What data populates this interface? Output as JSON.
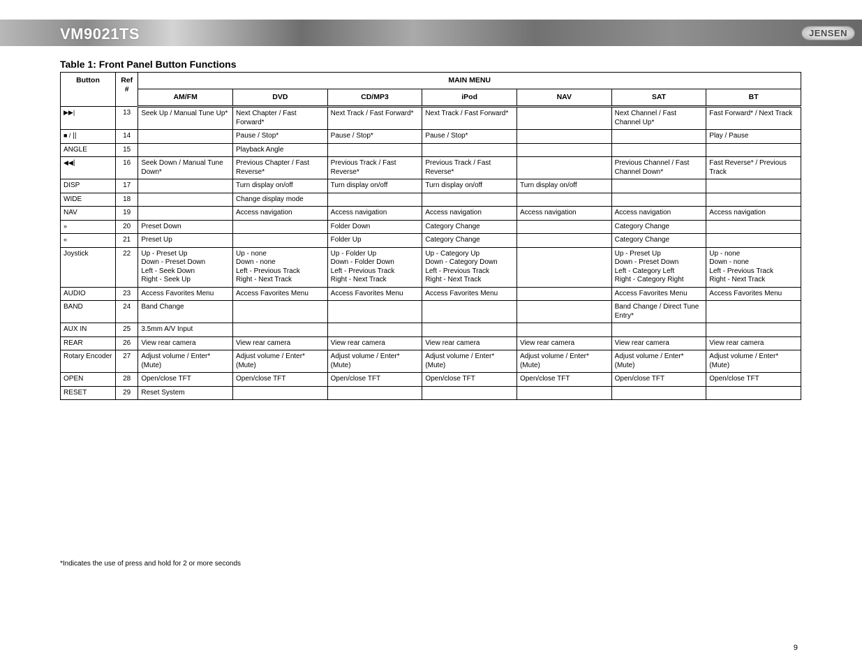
{
  "productTitle": "VM9021TS",
  "sectionTitle": "Table 1: Front Panel Button Functions",
  "logoText": "JENSEN",
  "pageNumber": "9",
  "headers": {
    "button": "Button",
    "ref": "Ref #",
    "main": "MAIN MENU",
    "modes": [
      "AM/FM",
      "DVD",
      "CD/MP3",
      "iPod",
      "NAV",
      "SAT",
      "BT"
    ]
  },
  "icons": {
    "next": "▶▶|",
    "stopPlay": "■ /",
    "rewind": "◀◀",
    "navDown": "»",
    "navUp": "«"
  },
  "rows": [
    {
      "button": "",
      "ref": "13",
      "cells": [
        "Seek Up / Manual Tune Up*",
        "Next Chapter / Fast Forward*",
        "Next Track / Fast Forward*",
        "Next Track / Fast Forward*",
        "",
        "Next Channel / Fast Channel Up*",
        "Fast Forward* / Next Track"
      ]
    },
    {
      "button": "   ||",
      "ref": "14",
      "cells": [
        "",
        "Pause / Stop*",
        "Pause / Stop*",
        "Pause / Stop*",
        "",
        "",
        "Play / Pause"
      ]
    },
    {
      "button": "ANGLE",
      "ref": "15",
      "cells": [
        "",
        "Playback Angle",
        "",
        "",
        "",
        "",
        ""
      ]
    },
    {
      "button": "|",
      "ref": "16",
      "cells": [
        "Seek Down / Manual Tune Down*",
        "Previous Chapter / Fast Reverse*",
        "Previous Track / Fast Reverse*",
        "Previous Track / Fast Reverse*",
        "",
        "Previous Channel / Fast Channel Down*",
        "Fast Reverse* / Previous Track"
      ]
    },
    {
      "button": "DISP",
      "ref": "17",
      "cells": [
        "",
        "Turn display on/off",
        "Turn display on/off",
        "Turn display on/off",
        "Turn display on/off",
        "",
        ""
      ]
    },
    {
      "button": "WIDE",
      "ref": "18",
      "cells": [
        "",
        "Change display mode",
        "",
        "",
        "",
        "",
        ""
      ]
    },
    {
      "button": "NAV",
      "ref": "19",
      "cells": [
        "",
        "Access navigation",
        "Access navigation",
        "Access navigation",
        "Access navigation",
        "Access navigation",
        "Access navigation"
      ]
    },
    {
      "button": "",
      "ref": "20",
      "cells": [
        "Preset Down",
        "",
        "Folder Down",
        "Category Change",
        "",
        "Category Change",
        ""
      ]
    },
    {
      "button": "",
      "ref": "21",
      "cells": [
        "Preset Up",
        "",
        "Folder Up",
        "Category Change",
        "",
        "Category Change",
        ""
      ]
    },
    {
      "button": "Joystick",
      "ref": "22",
      "cells": [
        "Up - Preset Up\nDown - Preset Down\nLeft - Seek Down\nRight - Seek Up",
        "Up - none\nDown - none\nLeft - Previous Track\nRight - Next Track",
        "Up - Folder Up\nDown - Folder Down\nLeft - Previous Track\nRight - Next Track",
        "Up - Category Up\nDown - Category Down\nLeft - Previous Track\nRight - Next Track",
        "",
        "Up - Preset Up\nDown - Preset Down\nLeft - Category Left\nRight - Category Right",
        "Up - none\nDown - none\nLeft - Previous Track\nRight - Next Track"
      ]
    },
    {
      "button": "AUDIO",
      "ref": "23",
      "cells": [
        "Access Favorites Menu",
        "Access Favorites Menu",
        "Access Favorites Menu",
        "Access Favorites Menu",
        "",
        "Access Favorites Menu",
        "Access Favorites Menu"
      ]
    },
    {
      "button": "BAND",
      "ref": "24",
      "cells": [
        "Band Change",
        "",
        "",
        "",
        "",
        "Band Change / Direct Tune Entry*",
        ""
      ]
    },
    {
      "button": "AUX IN",
      "ref": "25",
      "cells": [
        "3.5mm A/V Input",
        "",
        "",
        "",
        "",
        "",
        ""
      ]
    },
    {
      "button": "REAR",
      "ref": "26",
      "cells": [
        "View rear camera",
        "View rear camera",
        "View rear camera",
        "View rear camera",
        "View rear camera",
        "View rear camera",
        "View rear camera"
      ]
    },
    {
      "button": "Rotary Encoder",
      "ref": "27",
      "cells": [
        "Adjust volume / Enter* (Mute)",
        "Adjust volume / Enter* (Mute)",
        "Adjust volume / Enter* (Mute)",
        "Adjust volume / Enter* (Mute)",
        "Adjust volume / Enter* (Mute)",
        "Adjust volume / Enter* (Mute)",
        "Adjust volume / Enter* (Mute)"
      ]
    },
    {
      "button": "OPEN",
      "ref": "28",
      "cells": [
        "Open/close TFT",
        "Open/close TFT",
        "Open/close TFT",
        "Open/close TFT",
        "Open/close TFT",
        "Open/close TFT",
        "Open/close TFT"
      ]
    },
    {
      "button": "RESET",
      "ref": "29",
      "cells": [
        "Reset System",
        "",
        "",
        "",
        "",
        "",
        ""
      ]
    }
  ],
  "footnotes": [
    "*Indicates the use of press and hold for 2 or more seconds"
  ]
}
